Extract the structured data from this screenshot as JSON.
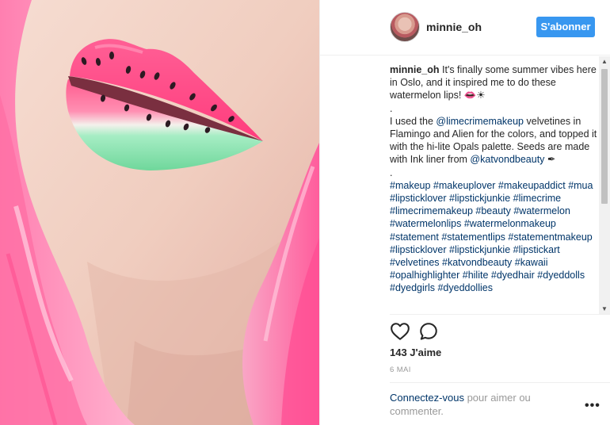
{
  "post": {
    "username": "minnie_oh",
    "follow_label": "S'abonner",
    "caption": {
      "author": "minnie_oh",
      "line1": "It's finally some summer vibes here in Oslo, and it inspired me to do these watermelon lips! 👄☀",
      "dot1": ".",
      "line2_pre": "I used the ",
      "mention1": "@limecrimemakeup",
      "line2_post": " velvetines in Flamingo and Alien for the colors, and topped it with the hi-lite Opals palette. Seeds are made with Ink liner from ",
      "mention2": "@katvondbeauty",
      "line2_end": " ✒",
      "dot2": ".",
      "hashtags": [
        "#makeup",
        "#makeuplover",
        "#makeupaddict",
        "#mua",
        "#lipsticklover",
        "#lipstickjunkie",
        "#limecrime",
        "#limecrimemakeup",
        "#beauty",
        "#watermelon",
        "#watermelonlips",
        "#watermelonmakeup",
        "#statement",
        "#statementlips",
        "#statementmakeup",
        "#lipsticklover",
        "#lipstickjunkie",
        "#lipstickart",
        "#velvetines",
        "#katvondbeauty",
        "#kawaii",
        "#opalhighlighter",
        "#hilite",
        "#dyedhair",
        "#dyeddolls",
        "#dyedgirls",
        "#dyeddollies"
      ]
    },
    "likes": "143 J'aime",
    "date": "6 MAI",
    "login_link": "Connectez-vous",
    "login_rest": " pour aimer ou commenter.",
    "more_label": "•••"
  },
  "icons": {
    "like": "heart-icon",
    "comment": "comment-icon"
  },
  "colors": {
    "follow_bg": "#3897f0",
    "link": "#003569",
    "lip_pink": "#ff4f86",
    "lip_green": "#7fe0a8"
  }
}
